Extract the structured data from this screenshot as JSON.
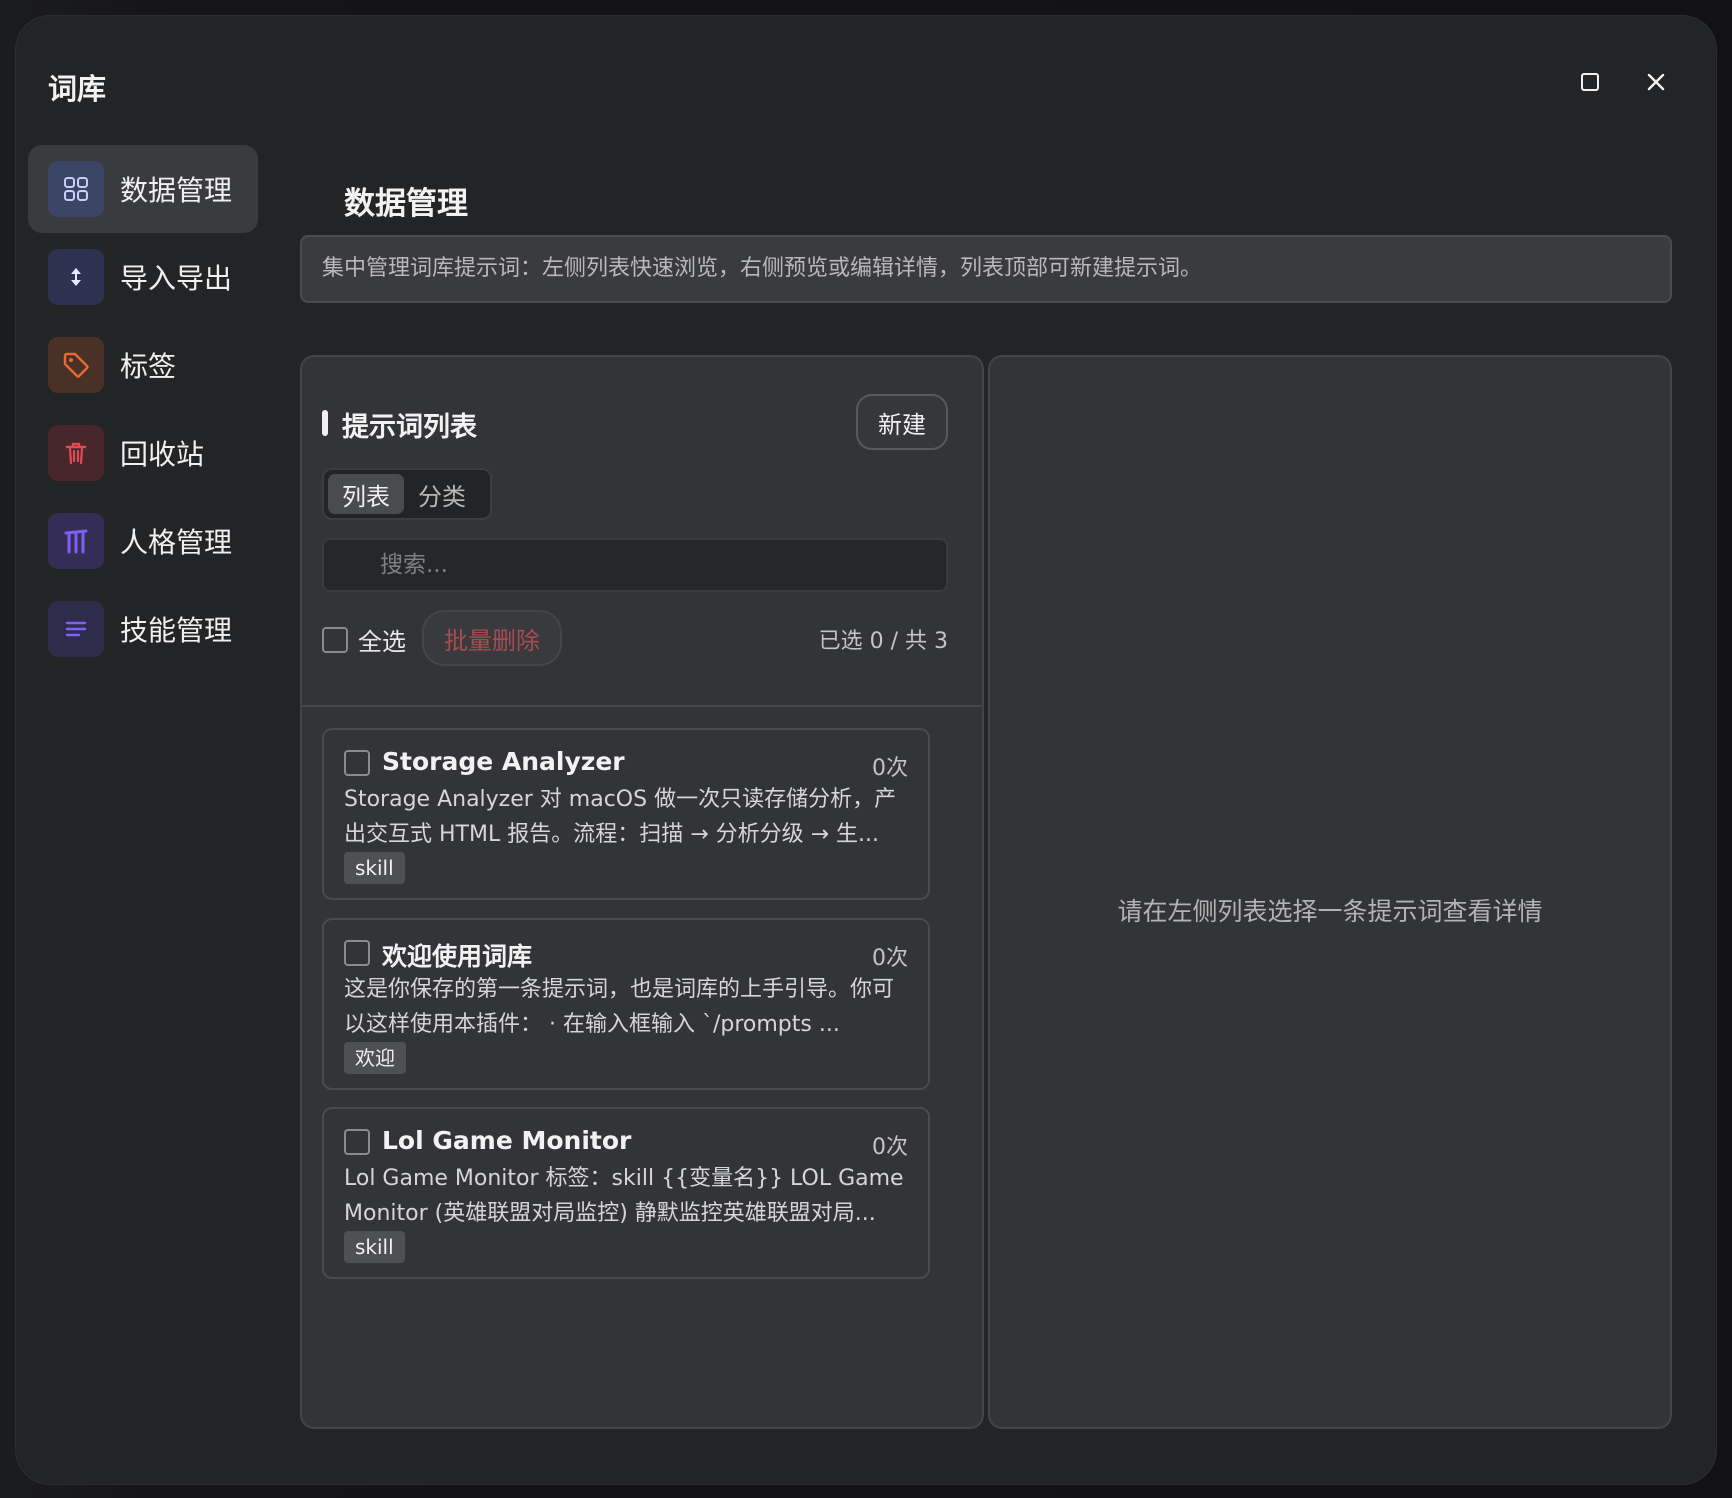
{
  "window": {
    "title": "词库"
  },
  "sidebar": {
    "items": [
      {
        "label": "数据管理",
        "icon": "grid-icon",
        "color": "#7a8fd6",
        "bg": "#3b4565"
      },
      {
        "label": "导入导出",
        "icon": "import-export-icon",
        "color": "#cfd6ff",
        "bg": "#2d3250"
      },
      {
        "label": "标签",
        "icon": "tag-icon",
        "color": "#e0652b",
        "bg": "#4a3128"
      },
      {
        "label": "回收站",
        "icon": "trash-icon",
        "color": "#e0484f",
        "bg": "#47272b"
      },
      {
        "label": "人格管理",
        "icon": "persona-icon",
        "color": "#7b5cf0",
        "bg": "#342d55"
      },
      {
        "label": "技能管理",
        "icon": "skill-list-icon",
        "color": "#7b5cf0",
        "bg": "#2f2b4a"
      }
    ]
  },
  "main": {
    "title": "数据管理",
    "description": "集中管理词库提示词：左侧列表快速浏览，右侧预览或编辑详情，列表顶部可新建提示词。"
  },
  "list": {
    "header": "提示词列表",
    "new_label": "新建",
    "tabs": [
      "列表",
      "分类"
    ],
    "search_placeholder": "搜索...",
    "select_all_label": "全选",
    "batch_delete_label": "批量删除",
    "selection_count": "已选 0 / 共 3",
    "items": [
      {
        "title": "Storage Analyzer",
        "count": "0次",
        "desc": "Storage Analyzer 对 macOS 做一次只读存储分析，产出交互式 HTML 报告。流程：扫描 → 分析分级 → 生...",
        "tag": "skill"
      },
      {
        "title": "欢迎使用词库",
        "count": "0次",
        "desc": "这是你保存的第一条提示词，也是词库的上手引导。你可以这样使用本插件： · 在输入框输入 `/prompts ...",
        "tag": "欢迎"
      },
      {
        "title": "Lol Game Monitor",
        "count": "0次",
        "desc": "Lol Game Monitor 标签：skill {{变量名}} LOL Game Monitor (英雄联盟对局监控) 静默监控英雄联盟对局...",
        "tag": "skill"
      }
    ]
  },
  "detail": {
    "empty_text": "请在左侧列表选择一条提示词查看详情"
  }
}
